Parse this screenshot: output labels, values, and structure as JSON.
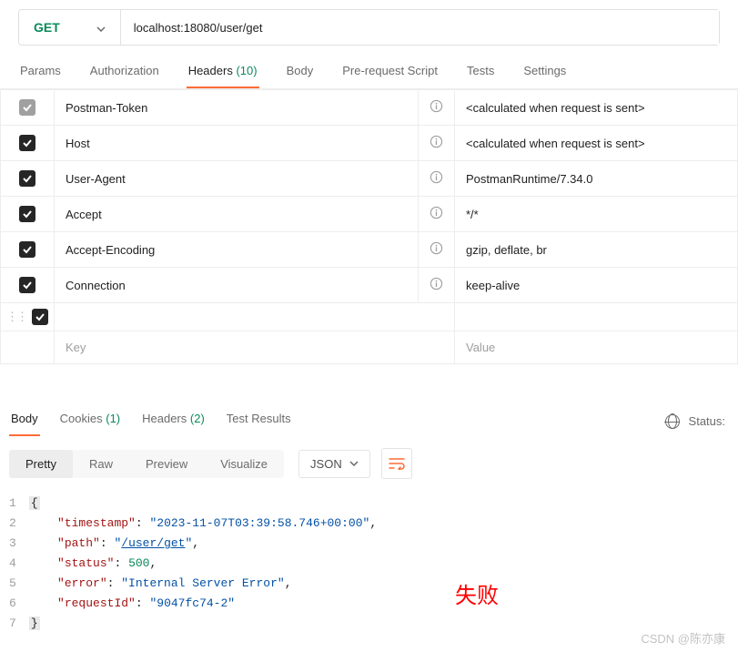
{
  "request": {
    "method": "GET",
    "url": "localhost:18080/user/get"
  },
  "tabs": {
    "params": "Params",
    "authorization": "Authorization",
    "headers_label": "Headers",
    "headers_count": "(10)",
    "body": "Body",
    "prerequest": "Pre-request Script",
    "tests": "Tests",
    "settings": "Settings"
  },
  "headers": [
    {
      "checked": "dim",
      "key": "Postman-Token",
      "value": "<calculated when request is sent>"
    },
    {
      "checked": "on",
      "key": "Host",
      "value": "<calculated when request is sent>"
    },
    {
      "checked": "on",
      "key": "User-Agent",
      "value": "PostmanRuntime/7.34.0"
    },
    {
      "checked": "on",
      "key": "Accept",
      "value": "*/*"
    },
    {
      "checked": "on",
      "key": "Accept-Encoding",
      "value": "gzip, deflate, br"
    },
    {
      "checked": "on",
      "key": "Connection",
      "value": "keep-alive"
    }
  ],
  "placeholders": {
    "key": "Key",
    "value": "Value"
  },
  "response_tabs": {
    "body": "Body",
    "cookies_label": "Cookies",
    "cookies_count": "(1)",
    "headers_label": "Headers",
    "headers_count": "(2)",
    "test_results": "Test Results",
    "status_label": "Status:"
  },
  "view_modes": {
    "pretty": "Pretty",
    "raw": "Raw",
    "preview": "Preview",
    "visualize": "Visualize",
    "format": "JSON"
  },
  "json_body": {
    "timestamp": "2023-11-07T03:39:58.746+00:00",
    "path": "/user/get",
    "status": 500,
    "error": "Internal Server Error",
    "requestId": "9047fc74-2"
  },
  "line_numbers": [
    "1",
    "2",
    "3",
    "4",
    "5",
    "6",
    "7"
  ],
  "annotation": "失败",
  "watermark": "CSDN @陈亦康"
}
